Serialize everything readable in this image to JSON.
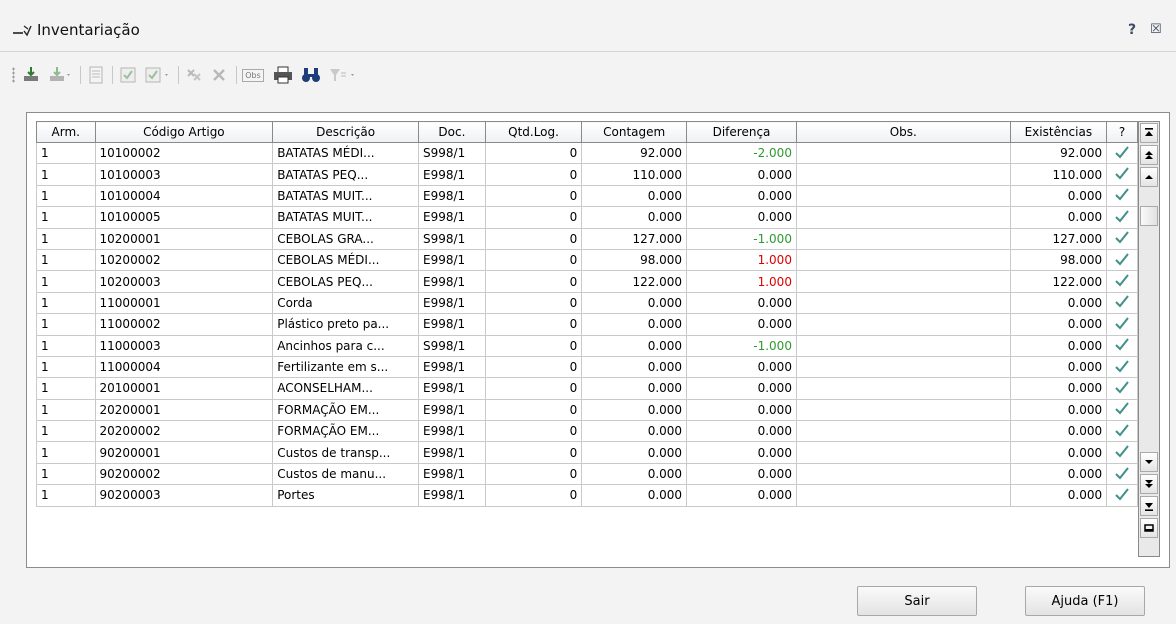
{
  "window": {
    "title": "Inventariação",
    "help_glyph": "?",
    "close_glyph": "☒"
  },
  "toolbar": {
    "items": [
      "import-icon",
      "import-dropdown-icon",
      "document-icon",
      "check-icon",
      "check-list-dropdown-icon",
      "delete-icon",
      "delete-all-icon",
      "obs-icon",
      "print-icon",
      "find-icon",
      "filter-dropdown-icon"
    ],
    "obs_label": "Obs"
  },
  "grid": {
    "columns": [
      "Arm.",
      "Código Artigo",
      "Descrição",
      "Doc.",
      "Qtd.Log.",
      "Contagem",
      "Diferença",
      "Obs.",
      "Existências",
      "?"
    ],
    "rows": [
      {
        "arm": "1",
        "codigo": "10100002",
        "descricao": "BATATAS MÉDI...",
        "doc": "S998/1",
        "qtd": "0",
        "contagem": "92.000",
        "diferenca": "-2.000",
        "obs": "",
        "existencias": "92.000"
      },
      {
        "arm": "1",
        "codigo": "10100003",
        "descricao": "BATATAS PEQ...",
        "doc": "E998/1",
        "qtd": "0",
        "contagem": "110.000",
        "diferenca": "0.000",
        "obs": "",
        "existencias": "110.000"
      },
      {
        "arm": "1",
        "codigo": "10100004",
        "descricao": "BATATAS MUIT...",
        "doc": "E998/1",
        "qtd": "0",
        "contagem": "0.000",
        "diferenca": "0.000",
        "obs": "",
        "existencias": "0.000"
      },
      {
        "arm": "1",
        "codigo": "10100005",
        "descricao": "BATATAS MUIT...",
        "doc": "E998/1",
        "qtd": "0",
        "contagem": "0.000",
        "diferenca": "0.000",
        "obs": "",
        "existencias": "0.000"
      },
      {
        "arm": "1",
        "codigo": "10200001",
        "descricao": "CEBOLAS GRA...",
        "doc": "S998/1",
        "qtd": "0",
        "contagem": "127.000",
        "diferenca": "-1.000",
        "obs": "",
        "existencias": "127.000"
      },
      {
        "arm": "1",
        "codigo": "10200002",
        "descricao": "CEBOLAS MÉDI...",
        "doc": "E998/1",
        "qtd": "0",
        "contagem": "98.000",
        "diferenca": "1.000",
        "obs": "",
        "existencias": "98.000"
      },
      {
        "arm": "1",
        "codigo": "10200003",
        "descricao": "CEBOLAS PEQ...",
        "doc": "E998/1",
        "qtd": "0",
        "contagem": "122.000",
        "diferenca": "1.000",
        "obs": "",
        "existencias": "122.000"
      },
      {
        "arm": "1",
        "codigo": "11000001",
        "descricao": "Corda",
        "doc": "E998/1",
        "qtd": "0",
        "contagem": "0.000",
        "diferenca": "0.000",
        "obs": "",
        "existencias": "0.000"
      },
      {
        "arm": "1",
        "codigo": "11000002",
        "descricao": "Plástico preto pa...",
        "doc": "E998/1",
        "qtd": "0",
        "contagem": "0.000",
        "diferenca": "0.000",
        "obs": "",
        "existencias": "0.000"
      },
      {
        "arm": "1",
        "codigo": "11000003",
        "descricao": "Ancinhos para c...",
        "doc": "S998/1",
        "qtd": "0",
        "contagem": "0.000",
        "diferenca": "-1.000",
        "obs": "",
        "existencias": "0.000"
      },
      {
        "arm": "1",
        "codigo": "11000004",
        "descricao": "Fertilizante em s...",
        "doc": "E998/1",
        "qtd": "0",
        "contagem": "0.000",
        "diferenca": "0.000",
        "obs": "",
        "existencias": "0.000"
      },
      {
        "arm": "1",
        "codigo": "20100001",
        "descricao": "ACONSELHAM...",
        "doc": "E998/1",
        "qtd": "0",
        "contagem": "0.000",
        "diferenca": "0.000",
        "obs": "",
        "existencias": "0.000"
      },
      {
        "arm": "1",
        "codigo": "20200001",
        "descricao": "FORMAÇÃO EM...",
        "doc": "E998/1",
        "qtd": "0",
        "contagem": "0.000",
        "diferenca": "0.000",
        "obs": "",
        "existencias": "0.000"
      },
      {
        "arm": "1",
        "codigo": "20200002",
        "descricao": "FORMAÇÃO EM...",
        "doc": "E998/1",
        "qtd": "0",
        "contagem": "0.000",
        "diferenca": "0.000",
        "obs": "",
        "existencias": "0.000"
      },
      {
        "arm": "1",
        "codigo": "90200001",
        "descricao": "Custos de transp...",
        "doc": "E998/1",
        "qtd": "0",
        "contagem": "0.000",
        "diferenca": "0.000",
        "obs": "",
        "existencias": "0.000"
      },
      {
        "arm": "1",
        "codigo": "90200002",
        "descricao": "Custos de manu...",
        "doc": "E998/1",
        "qtd": "0",
        "contagem": "0.000",
        "diferenca": "0.000",
        "obs": "",
        "existencias": "0.000"
      },
      {
        "arm": "1",
        "codigo": "90200003",
        "descricao": "Portes",
        "doc": "E998/1",
        "qtd": "0",
        "contagem": "0.000",
        "diferenca": "0.000",
        "obs": "",
        "existencias": "0.000"
      }
    ]
  },
  "scrollbar": {
    "buttons": [
      "first-page-icon",
      "page-up-icon",
      "scroll-up-icon",
      "scroll-down-icon",
      "page-down-icon",
      "last-page-icon",
      "minimize-icon"
    ]
  },
  "buttons": {
    "exit_label": "Sair",
    "help_label": "Ajuda (F1)"
  },
  "colors": {
    "negative": "#2e9a2e",
    "positive": "#e00000",
    "check": "#3f8f8a"
  }
}
